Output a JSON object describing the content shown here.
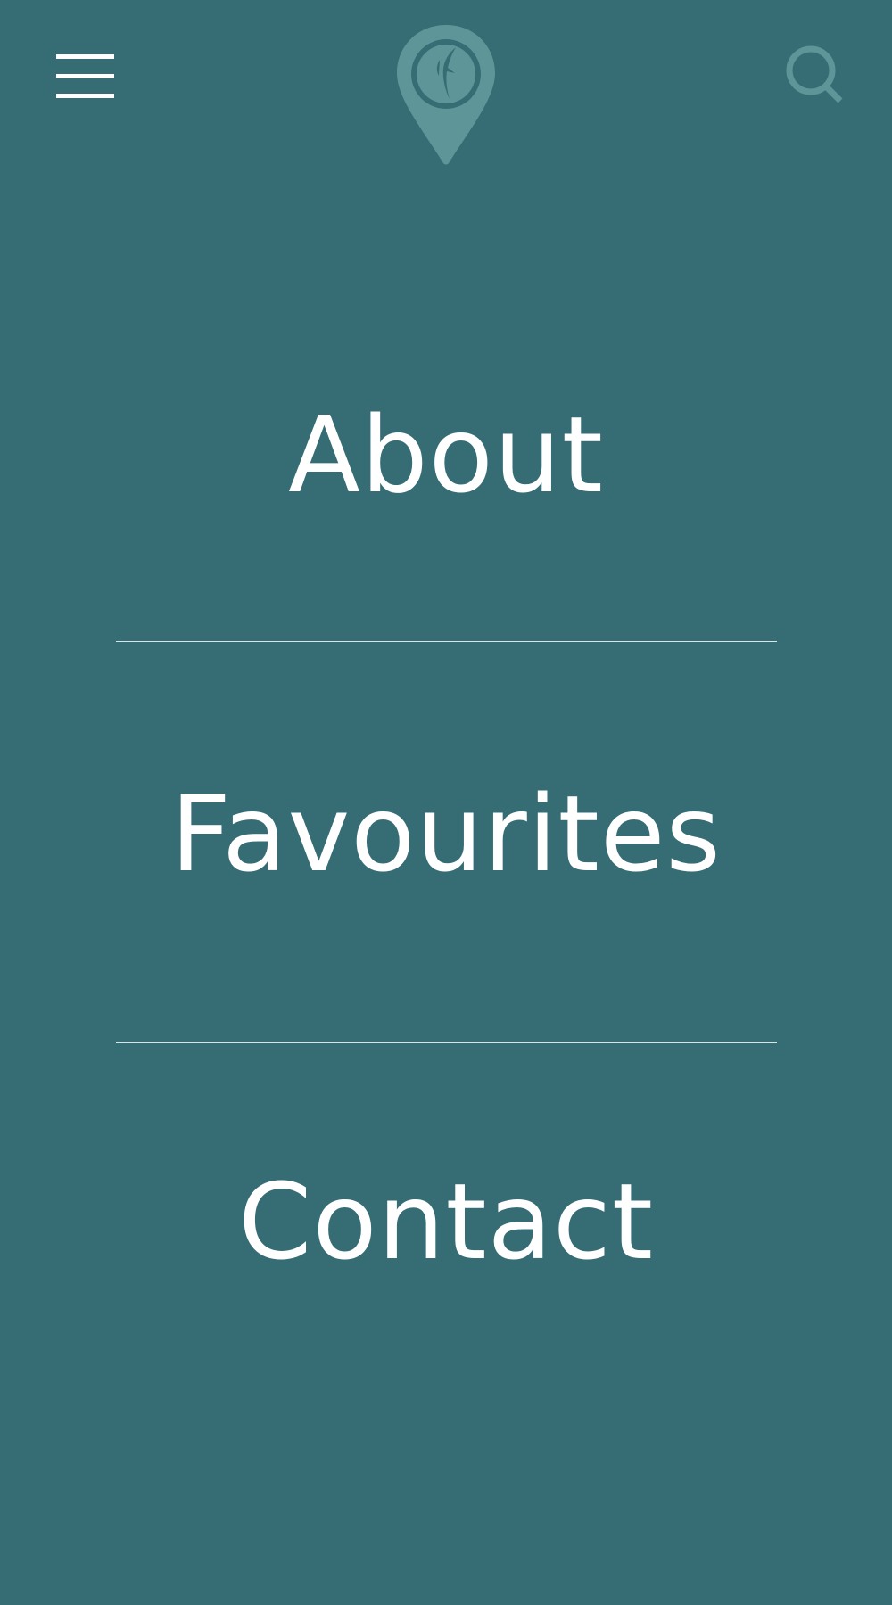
{
  "header": {
    "menu_icon": "hamburger-menu-icon",
    "logo_icon": "map-pin-leaf-logo",
    "search_icon": "search-icon"
  },
  "nav": {
    "items": [
      {
        "label": "About"
      },
      {
        "label": "Favourites"
      },
      {
        "label": "Contact"
      }
    ]
  },
  "colors": {
    "background": "#366d75",
    "text": "#ffffff",
    "logo_accent": "#5e9598",
    "divider": "#d9e6e8"
  }
}
